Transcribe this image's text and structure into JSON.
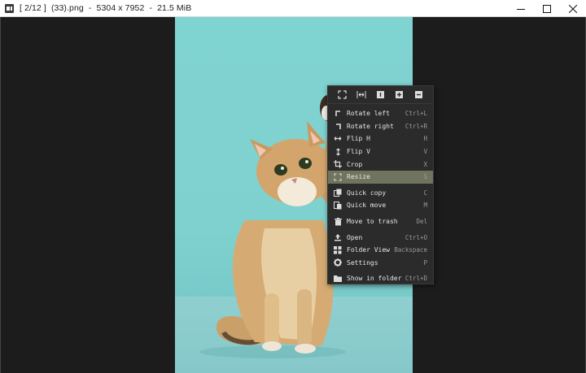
{
  "window": {
    "title": "[ 2/12 ]  (33).png  -  5304 x 7952  -  21.5 MiB",
    "controls": [
      "minimize",
      "maximize",
      "close"
    ]
  },
  "image": {
    "description_icon": "cat-photo",
    "background_color": "#7fd3d1"
  },
  "menu": {
    "top_icons": [
      "fullscreen-icon",
      "fit-width-icon",
      "actual-size-icon",
      "zoom-in-icon",
      "zoom-out-icon"
    ],
    "items": [
      {
        "label": "Rotate left",
        "shortcut": "Ctrl+L",
        "icon": "rotate-left-icon"
      },
      {
        "label": "Rotate right",
        "shortcut": "Ctrl+R",
        "icon": "rotate-right-icon"
      },
      {
        "label": "Flip H",
        "shortcut": "H",
        "icon": "flip-h-icon"
      },
      {
        "label": "Flip V",
        "shortcut": "V",
        "icon": "flip-v-icon"
      },
      {
        "label": "Crop",
        "shortcut": "X",
        "icon": "crop-icon"
      },
      {
        "label": "Resize",
        "shortcut": "S",
        "icon": "resize-icon",
        "active": true
      },
      {
        "label": "Quick copy",
        "shortcut": "C",
        "icon": "copy-icon"
      },
      {
        "label": "Quick move",
        "shortcut": "M",
        "icon": "move-icon"
      },
      {
        "label": "Move to trash",
        "shortcut": "Del",
        "icon": "trash-icon"
      },
      {
        "label": "Open",
        "shortcut": "Ctrl+O",
        "icon": "open-icon"
      },
      {
        "label": "Folder View",
        "shortcut": "Backspace",
        "icon": "grid-icon"
      },
      {
        "label": "Settings",
        "shortcut": "P",
        "icon": "gear-icon"
      },
      {
        "label": "Show in folder",
        "shortcut": "Ctrl+D",
        "icon": "folder-icon"
      }
    ]
  }
}
